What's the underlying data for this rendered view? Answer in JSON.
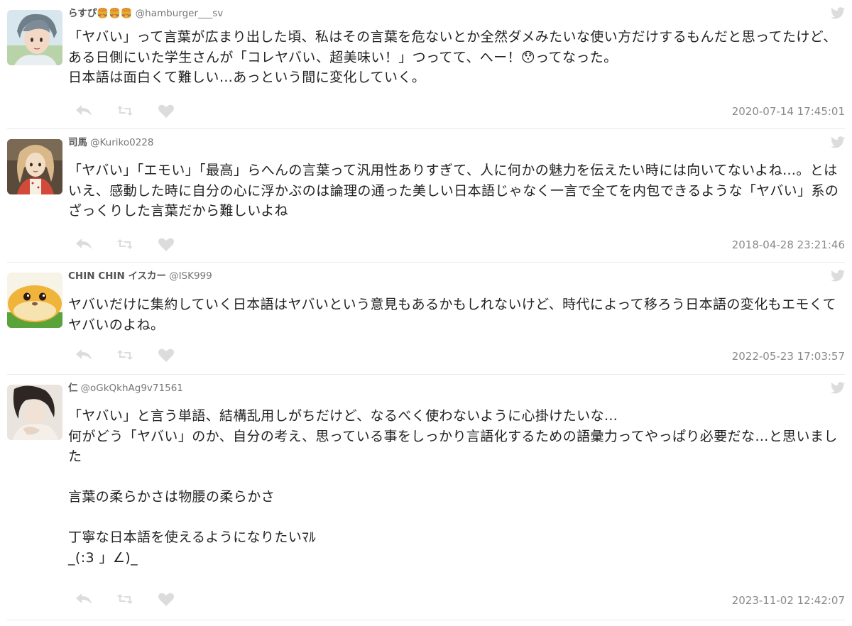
{
  "tweets": [
    {
      "name": "らすぴ🍔🍔🍔",
      "handle": "@hamburger___sv",
      "text": "「ヤバい」って言葉が広まり出した頃、私はその言葉を危ないとか全然ダメみたいな使い方だけするもんだと思ってたけど、ある日側にいた学生さんが「コレヤバい、超美味い！」つってて、へー！😯ってなった。\n日本語は面白くて難しい…あっという間に変化していく。",
      "timestamp": "2020-07-14 17:45:01",
      "avatar_icon": "anime-character-avatar"
    },
    {
      "name": "司馬",
      "handle": "@Kuriko0228",
      "text": "「ヤバい」「エモい」「最高」らへんの言葉って汎用性ありすぎて、人に何かの魅力を伝えたい時には向いてないよね…。とはいえ、感動した時に自分の心に浮かぶのは論理の通った美しい日本語じゃなく一言で全てを内包できるような「ヤバい」系のざっくりした言葉だから難しいよね",
      "timestamp": "2018-04-28 23:21:46",
      "avatar_icon": "doll-photo-avatar"
    },
    {
      "name": "CHIN CHIN イスカー",
      "handle": "@ISK999",
      "text": "ヤバいだけに集約していく日本語はヤバいという意見もあるかもしれないけど、時代によって移ろう日本語の変化もエモくてヤバいのよね。",
      "timestamp": "2022-05-23 17:03:57",
      "avatar_icon": "guinea-pig-avatar"
    },
    {
      "name": "仁",
      "handle": "@oGkQkhAg9v71561",
      "text": "「ヤバい」と言う単語、結構乱用しがちだけど、なるべく使わないように心掛けたいな…\n何がどう「ヤバい」のか、自分の考え、思っている事をしっかり言語化するための語彙力ってやっぱり必要だな…と思いました\n\n言葉の柔らかさは物腰の柔らかさ\n\n丁寧な日本語を使えるようになりたいﾏﾙ\n_(:3 」∠)_",
      "timestamp": "2023-11-02 12:42:07",
      "avatar_icon": "person-photo-avatar"
    }
  ],
  "icons": {
    "reply": "reply-icon",
    "retweet": "retweet-icon",
    "like": "heart-icon",
    "twitter": "twitter-bird-icon"
  },
  "colors": {
    "icon_gray": "#dcdcdc",
    "timestamp": "#8a8a8a",
    "divider": "#e6ecf0"
  }
}
